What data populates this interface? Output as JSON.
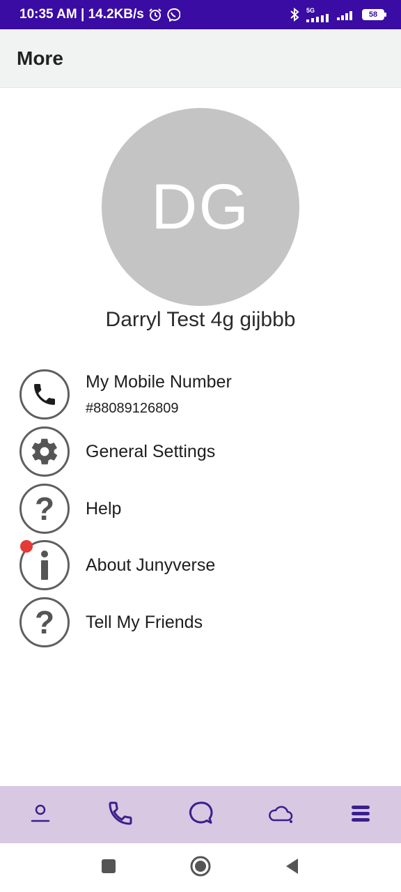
{
  "status_bar": {
    "time_speed": "10:35 AM | 14.2KB/s",
    "network_label": "5G",
    "battery": "58",
    "icons": [
      "alarm-icon",
      "viber-icon",
      "bluetooth-icon",
      "signal-icon",
      "signal-icon",
      "battery-icon"
    ]
  },
  "header": {
    "title": "More"
  },
  "profile": {
    "initials": "DG",
    "name": "Darryl Test 4g gijbbb"
  },
  "menu": [
    {
      "label": "My Mobile Number",
      "sub": "#88089126809",
      "icon": "phone-icon"
    },
    {
      "label": "General Settings",
      "icon": "gear-icon"
    },
    {
      "label": "Help",
      "icon": "help-icon"
    },
    {
      "label": "About Junyverse",
      "icon": "info-icon",
      "badge": true
    },
    {
      "label": "Tell My Friends",
      "icon": "help-icon"
    }
  ],
  "bottom_nav": [
    "contacts-icon",
    "phone-icon",
    "chat-icon",
    "cloud-icon",
    "menu-icon"
  ],
  "colors": {
    "status_bar": "#3a0ca3",
    "nav_bg": "#d8c8e2",
    "nav_icon": "#3a1f8c",
    "badge": "#e53935",
    "avatar": "#c4c4c4"
  }
}
